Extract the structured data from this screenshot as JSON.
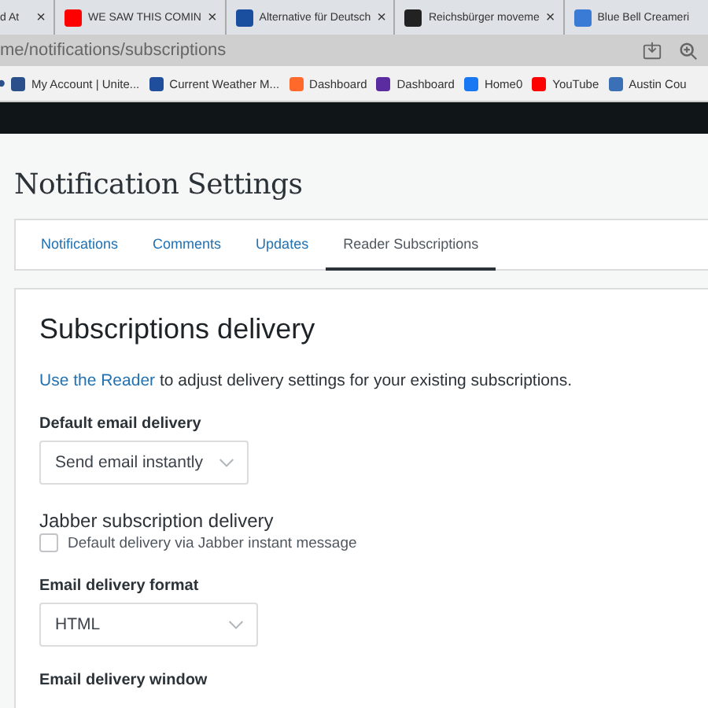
{
  "browser": {
    "tabs": [
      {
        "title": "d At"
      },
      {
        "title": "WE SAW THIS COMIN",
        "color": "#ff0000"
      },
      {
        "title": "Alternative für Deutsch",
        "color": "#1a4fa0"
      },
      {
        "title": "Reichsbürger moveme",
        "color": "#222222"
      },
      {
        "title": "Blue Bell Creameri",
        "color": "#3a7bd5"
      }
    ],
    "close_glyph": "×",
    "address": "me/notifications/subscriptions",
    "bookmarks": [
      {
        "label": "My Account | Unite...",
        "color": "#2a4f8a"
      },
      {
        "label": "Current Weather M...",
        "color": "#1f4e9c"
      },
      {
        "label": "Dashboard",
        "color": "#ff6a2b"
      },
      {
        "label": "Dashboard",
        "color": "#5b2ca0"
      },
      {
        "label": "Home0",
        "color": "#1877f2"
      },
      {
        "label": "YouTube",
        "color": "#ff0000"
      },
      {
        "label": "Austin Cou",
        "color": "#3b6fb6"
      }
    ]
  },
  "page": {
    "title": "Notification Settings",
    "tabs": [
      {
        "label": "Notifications",
        "selected": false
      },
      {
        "label": "Comments",
        "selected": false
      },
      {
        "label": "Updates",
        "selected": false
      },
      {
        "label": "Reader Subscriptions",
        "selected": true
      }
    ],
    "section": {
      "title": "Subscriptions delivery",
      "intro": {
        "link": "Use the Reader",
        "text": "to adjust delivery settings for your existing subscriptions."
      },
      "fields": [
        {
          "kind": "select",
          "label": "Default email delivery",
          "value": "Send email instantly"
        },
        {
          "kind": "checkbox",
          "label": "Jabber subscription delivery",
          "option": "Default delivery via Jabber instant message",
          "checked": false
        },
        {
          "kind": "select",
          "label": "Email delivery format",
          "value": "HTML"
        },
        {
          "kind": "heading",
          "label": "Email delivery window"
        }
      ]
    }
  }
}
